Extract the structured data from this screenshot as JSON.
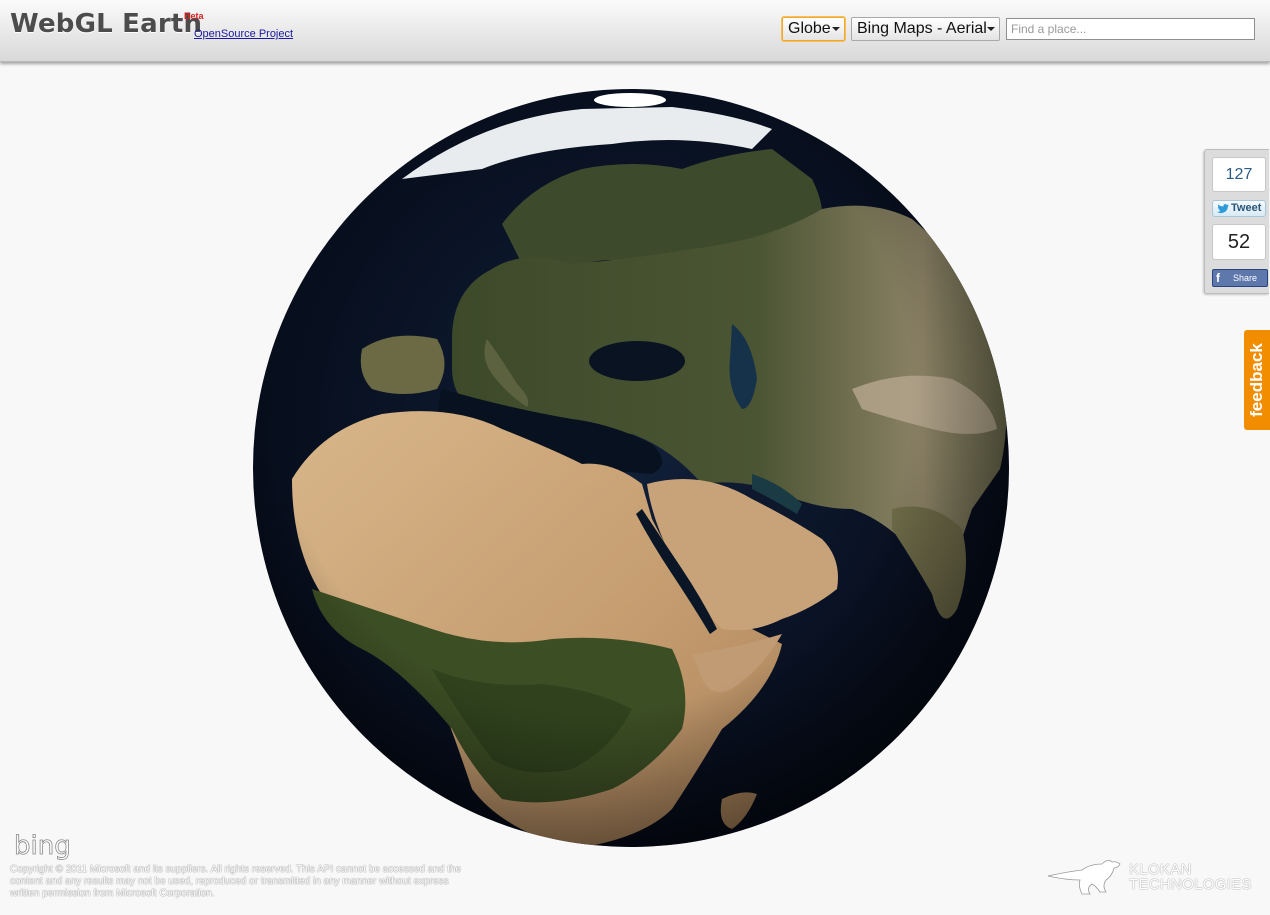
{
  "header": {
    "title": "WebGL Earth",
    "badge": "Beta",
    "project_link": "OpenSource Project",
    "mode_select": {
      "value": "Globe"
    },
    "layer_select": {
      "value": "Bing Maps - Aerial"
    },
    "search": {
      "placeholder": "Find a place..."
    }
  },
  "social": {
    "tweet_count": "127",
    "tweet_label": "Tweet",
    "share_count": "52",
    "share_label": "Share"
  },
  "feedback": {
    "label": "feedback"
  },
  "footer": {
    "provider_logo": "bing",
    "copyright": "Copyright © 2011 Microsoft and its suppliers. All rights reserved. This API cannot be accessed and the content and any results may not be used, reproduced or transmitted in any manner without express written permission from Microsoft Corporation.",
    "company_line1": "KLOKAN",
    "company_line2": "TECHNOLOGIES"
  },
  "colors": {
    "accent_orange": "#f28d00",
    "ocean": "#0b1526",
    "desert": "#c9a77c",
    "vegetation": "#3b4b26"
  },
  "icons": [
    "twitter-bird-icon",
    "facebook-icon",
    "kangaroo-logo-icon",
    "dropdown-arrow-icon"
  ]
}
